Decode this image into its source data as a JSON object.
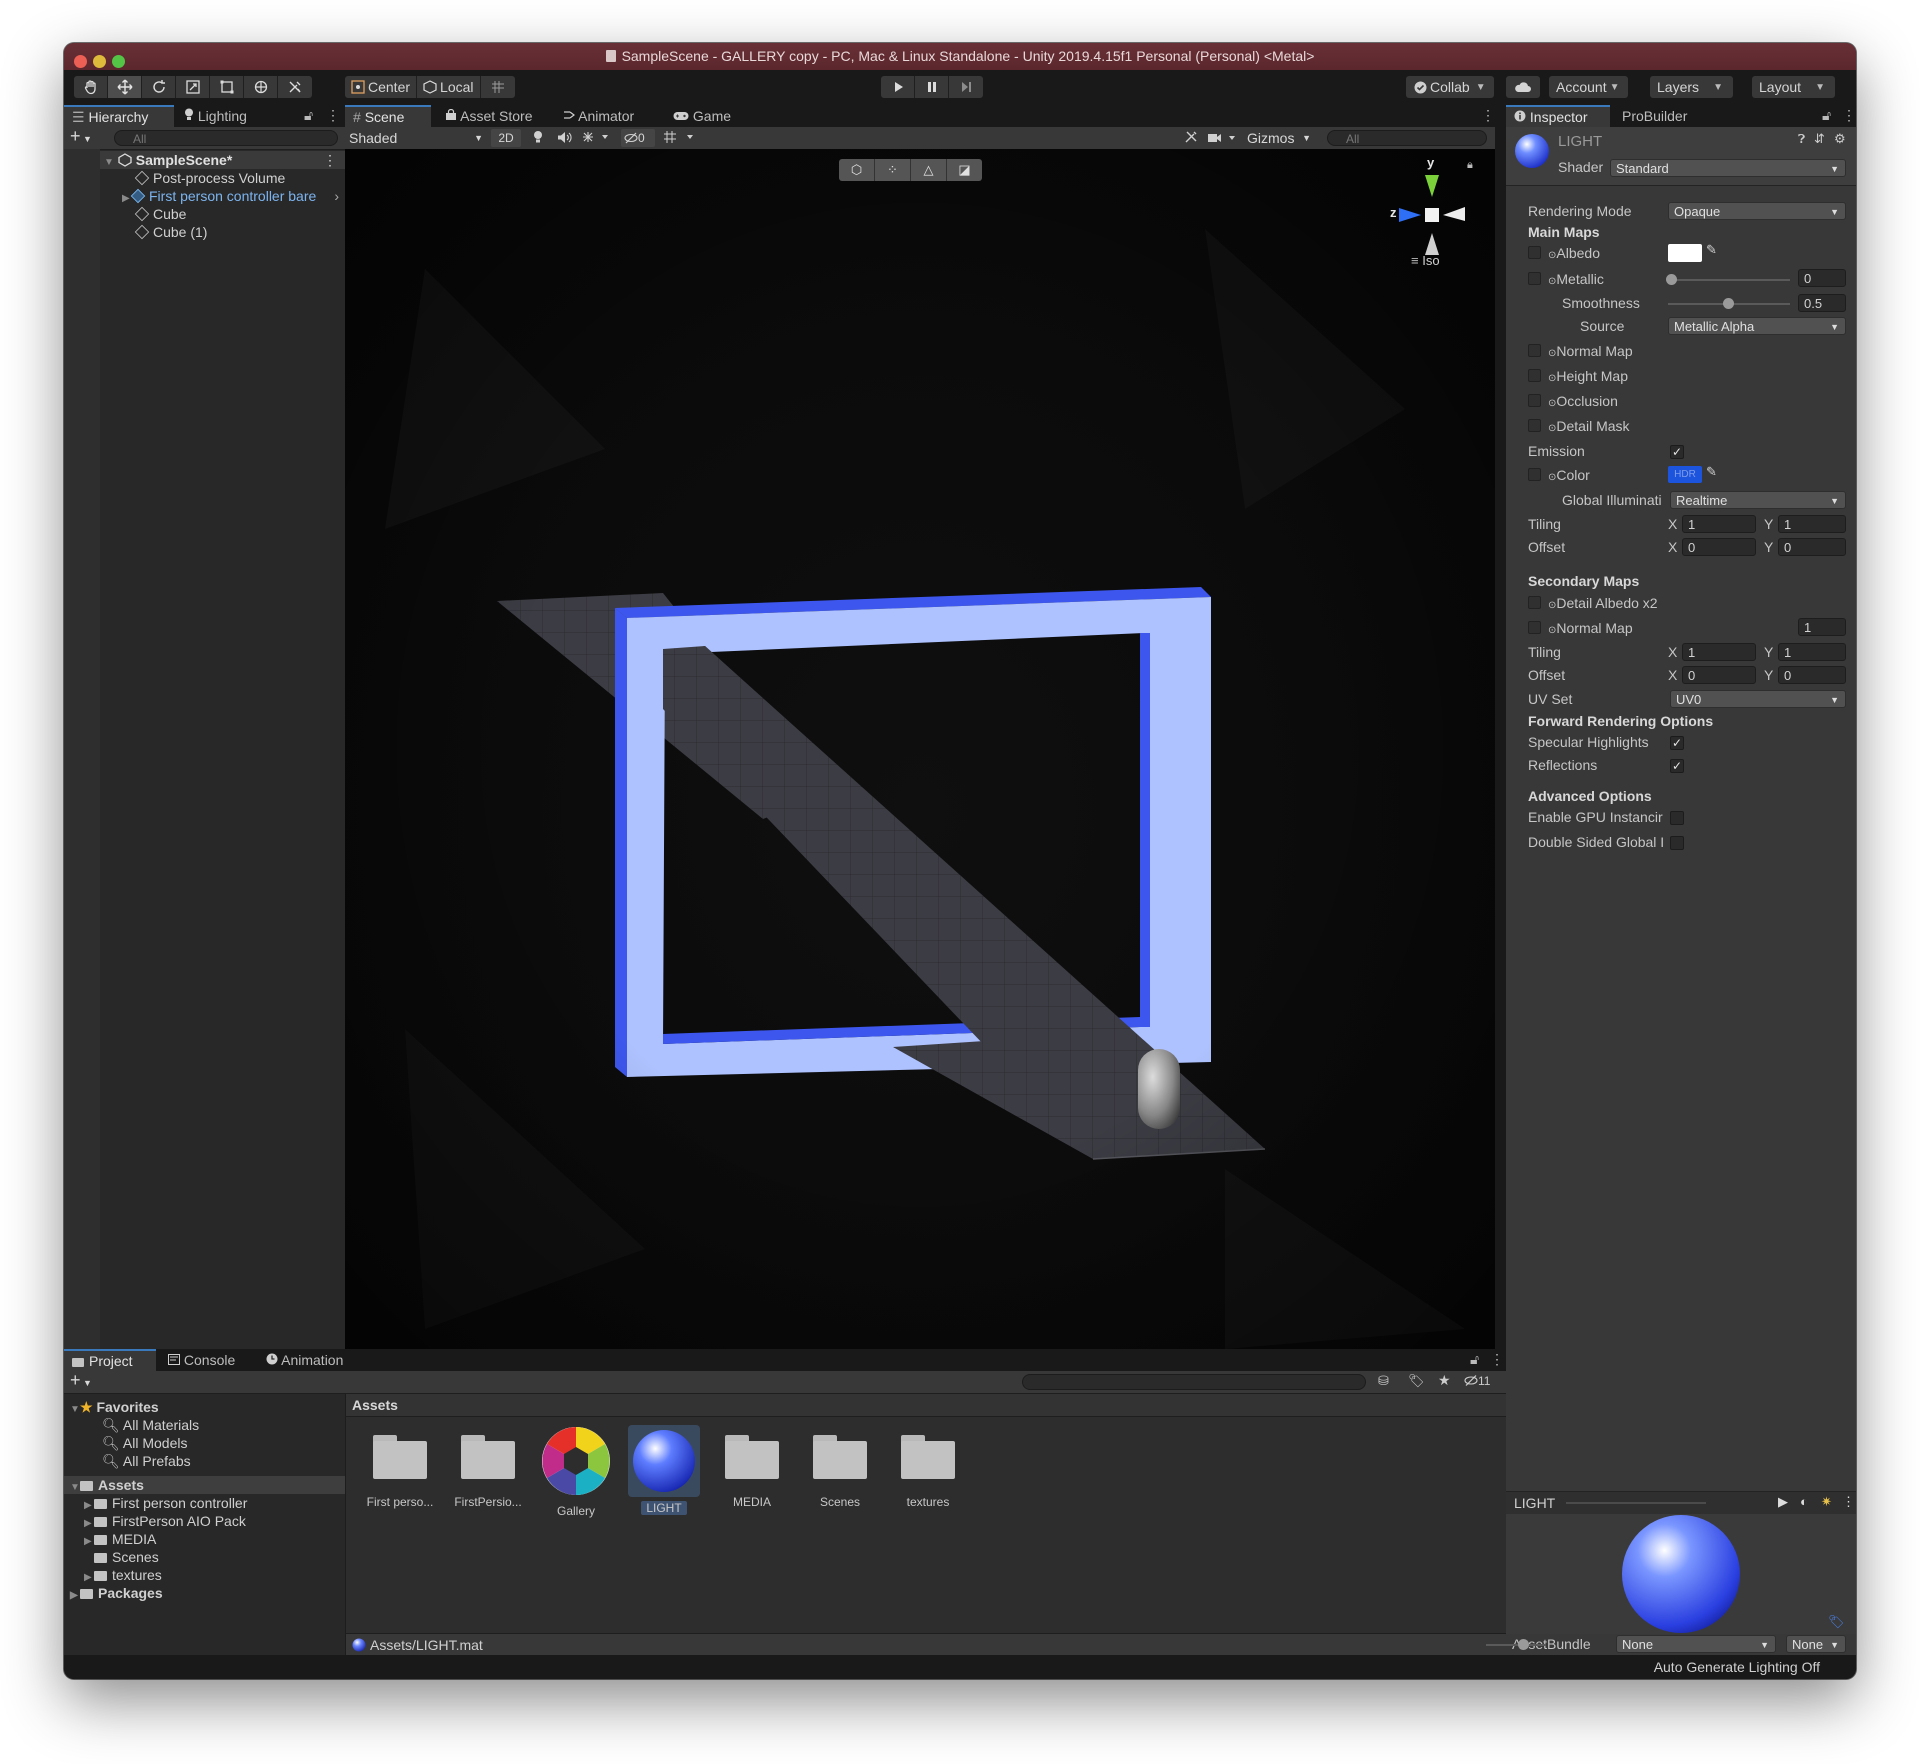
{
  "window": {
    "title": "SampleScene - GALLERY copy - PC, Mac & Linux Standalone - Unity 2019.4.15f1 Personal (Personal) <Metal>"
  },
  "toolbar": {
    "tools": [
      "hand-tool",
      "move-tool",
      "rotate-tool",
      "scale-tool",
      "rect-tool",
      "transform-tool",
      "custom-tool"
    ],
    "pivot": "Center",
    "space": "Local",
    "collab": "Collab",
    "account": "Account",
    "layers": "Layers",
    "layout": "Layout"
  },
  "hierarchy": {
    "tabs": [
      "Hierarchy",
      "Lighting"
    ],
    "search_placeholder": "All",
    "scene": "SampleScene*",
    "items": [
      "Post-process Volume",
      "First person controller bare",
      "Cube",
      "Cube (1)"
    ]
  },
  "scene_view": {
    "tabs": [
      "Scene",
      "Asset Store",
      "Animator",
      "Game"
    ],
    "shading": "Shaded",
    "mode_2d": "2D",
    "hidden_count": "0",
    "gizmos": "Gizmos",
    "search_placeholder": "All",
    "axis_y": "y",
    "axis_z": "z",
    "projection": "Iso"
  },
  "inspector": {
    "tabs": [
      "Inspector",
      "ProBuilder"
    ],
    "material_name": "LIGHT",
    "shader_label": "Shader",
    "shader": "Standard",
    "rendering_mode_label": "Rendering Mode",
    "rendering_mode": "Opaque",
    "main_maps": "Main Maps",
    "albedo": "Albedo",
    "metallic": "Metallic",
    "metallic_value": "0",
    "smoothness": "Smoothness",
    "smoothness_value": "0.5",
    "source": "Source",
    "source_value": "Metallic Alpha",
    "normal_map": "Normal Map",
    "height_map": "Height Map",
    "occlusion": "Occlusion",
    "detail_mask": "Detail Mask",
    "emission": "Emission",
    "color": "Color",
    "hdr": "HDR",
    "gi_label": "Global Illuminati",
    "gi_value": "Realtime",
    "tiling": "Tiling",
    "offset": "Offset",
    "x": "X",
    "y": "Y",
    "main_tiling": [
      "1",
      "1"
    ],
    "main_offset": [
      "0",
      "0"
    ],
    "secondary_maps": "Secondary Maps",
    "detail_albedo": "Detail Albedo x2",
    "normal_map_2": "Normal Map",
    "normal_scale": "1",
    "sec_tiling": [
      "1",
      "1"
    ],
    "sec_offset": [
      "0",
      "0"
    ],
    "uv_set": "UV Set",
    "uv_value": "UV0",
    "forward_options": "Forward Rendering Options",
    "specular": "Specular Highlights",
    "reflections": "Reflections",
    "advanced": "Advanced Options",
    "gpu_instancing": "Enable GPU Instancir",
    "double_sided": "Double Sided Global I",
    "preview_title": "LIGHT",
    "assetbundle_label": "AssetBundle",
    "assetbundle_value": "None",
    "assetbundle_variant": "None"
  },
  "project": {
    "tabs": [
      "Project",
      "Console",
      "Animation"
    ],
    "favorites": "Favorites",
    "favorite_items": [
      "All Materials",
      "All Models",
      "All Prefabs"
    ],
    "assets": "Assets",
    "asset_folders": [
      "First person controller",
      "FirstPerson AIO Pack",
      "MEDIA",
      "Scenes",
      "textures"
    ],
    "packages": "Packages",
    "breadcrumb": "Assets",
    "hidden_count": "11",
    "grid": [
      "First perso...",
      "FirstPersio...",
      "Gallery",
      "LIGHT",
      "MEDIA",
      "Scenes",
      "textures"
    ],
    "selected_path": "Assets/LIGHT.mat"
  },
  "status": {
    "lighting": "Auto Generate Lighting Off"
  },
  "colors": {
    "accent": "#3a79bb",
    "frame_light": "#aec2ff",
    "frame_dark": "#3d57ee",
    "title_bar": "#5e2a30"
  }
}
